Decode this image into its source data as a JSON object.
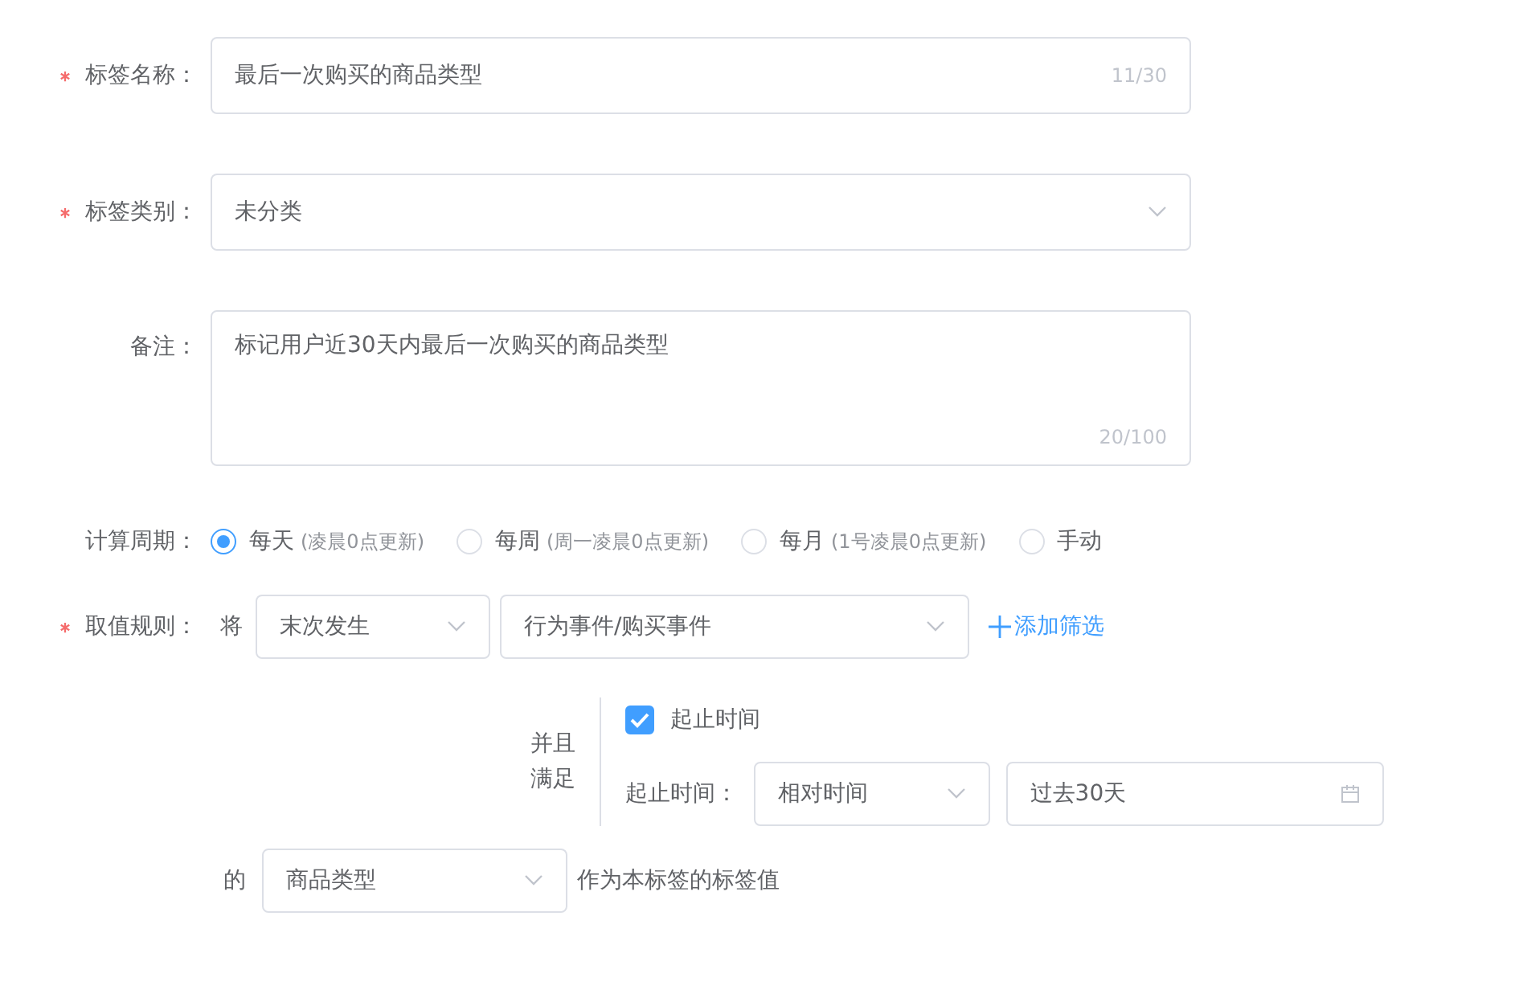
{
  "name_field": {
    "label": "标签名称：",
    "required": true,
    "value": "最后一次购买的商品类型",
    "count": "11/30"
  },
  "category_field": {
    "label": "标签类别：",
    "required": true,
    "value": "未分类"
  },
  "remark_field": {
    "label": "备注：",
    "required": false,
    "value": "标记用户近30天内最后一次购买的商品类型",
    "count": "20/100"
  },
  "cycle": {
    "label": "计算周期：",
    "required": false,
    "options": [
      {
        "label": "每天",
        "hint": "(凌晨0点更新)",
        "selected": true
      },
      {
        "label": "每周",
        "hint": "(周一凌晨0点更新)",
        "selected": false
      },
      {
        "label": "每月",
        "hint": "(1号凌晨0点更新)",
        "selected": false
      },
      {
        "label": "手动",
        "selected": false
      }
    ]
  },
  "rule": {
    "label": "取值规则：",
    "required": true,
    "prefix": "将",
    "occurrence": "末次发生",
    "event": "行为事件/购买事件",
    "add_filter": "添加筛选",
    "conjunction": "并且满足",
    "condition": {
      "checkbox_label": "起止时间",
      "checked": true,
      "time_label": "起止时间：",
      "time_type": "相对时间",
      "time_value": "过去30天"
    },
    "of_text": "的",
    "property": "商品类型",
    "suffix": "作为本标签的标签值"
  }
}
